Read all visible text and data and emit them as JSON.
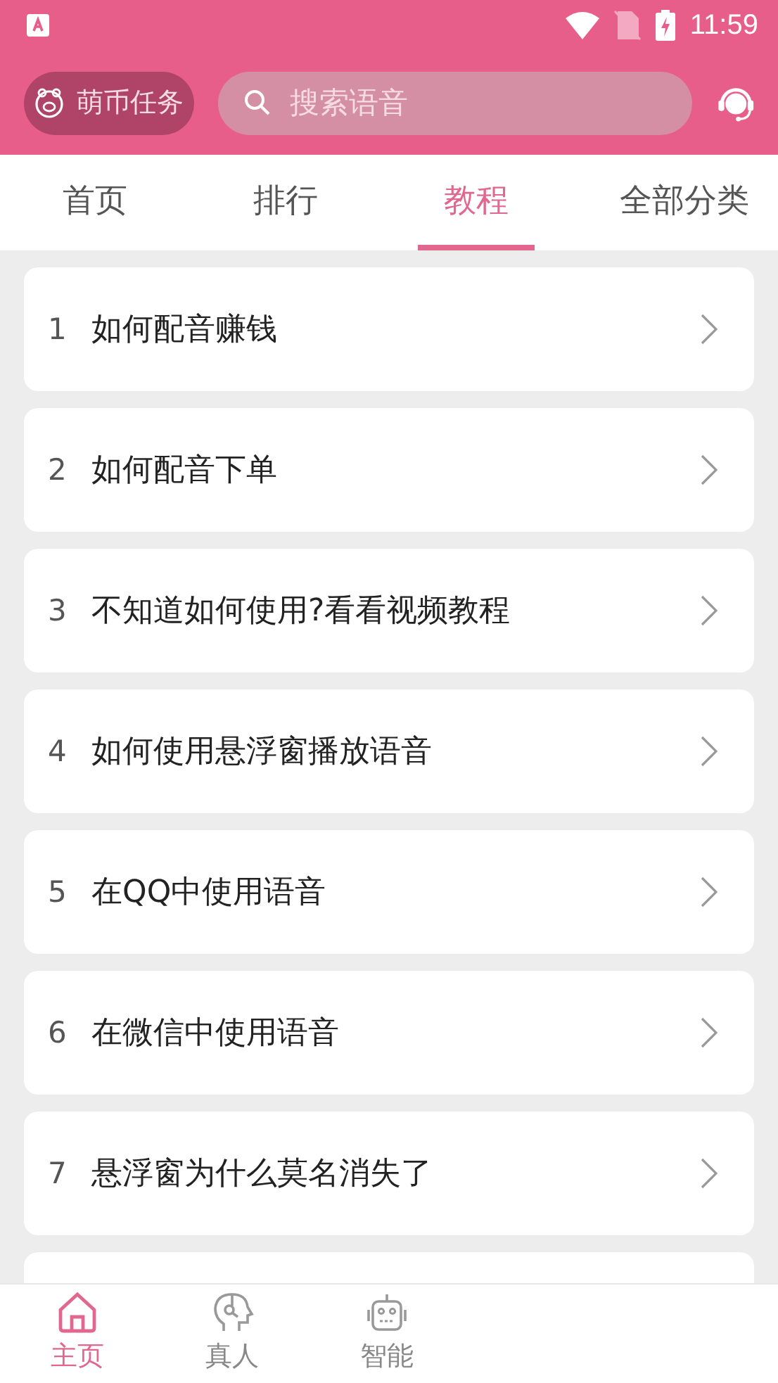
{
  "status_bar": {
    "time": "11:59"
  },
  "header": {
    "task_button": "萌币任务",
    "search": {
      "placeholder": "搜索语音"
    }
  },
  "tabs": [
    {
      "label": "首页",
      "selected": false
    },
    {
      "label": "排行",
      "selected": false
    },
    {
      "label": "教程",
      "selected": true
    },
    {
      "label": "全部分类",
      "selected": false
    }
  ],
  "tutorials": [
    {
      "number": "1",
      "title": "如何配音赚钱"
    },
    {
      "number": "2",
      "title": "如何配音下单"
    },
    {
      "number": "3",
      "title": "不知道如何使用?看看视频教程"
    },
    {
      "number": "4",
      "title": "如何使用悬浮窗播放语音"
    },
    {
      "number": "5",
      "title": "在QQ中使用语音"
    },
    {
      "number": "6",
      "title": "在微信中使用语音"
    },
    {
      "number": "7",
      "title": "悬浮窗为什么莫名消失了"
    }
  ],
  "bottom_nav": [
    {
      "kind": "home",
      "label": "主页",
      "selected": true
    },
    {
      "kind": "human",
      "label": "真人",
      "selected": false
    },
    {
      "kind": "robot",
      "label": "智能",
      "selected": false
    }
  ]
}
